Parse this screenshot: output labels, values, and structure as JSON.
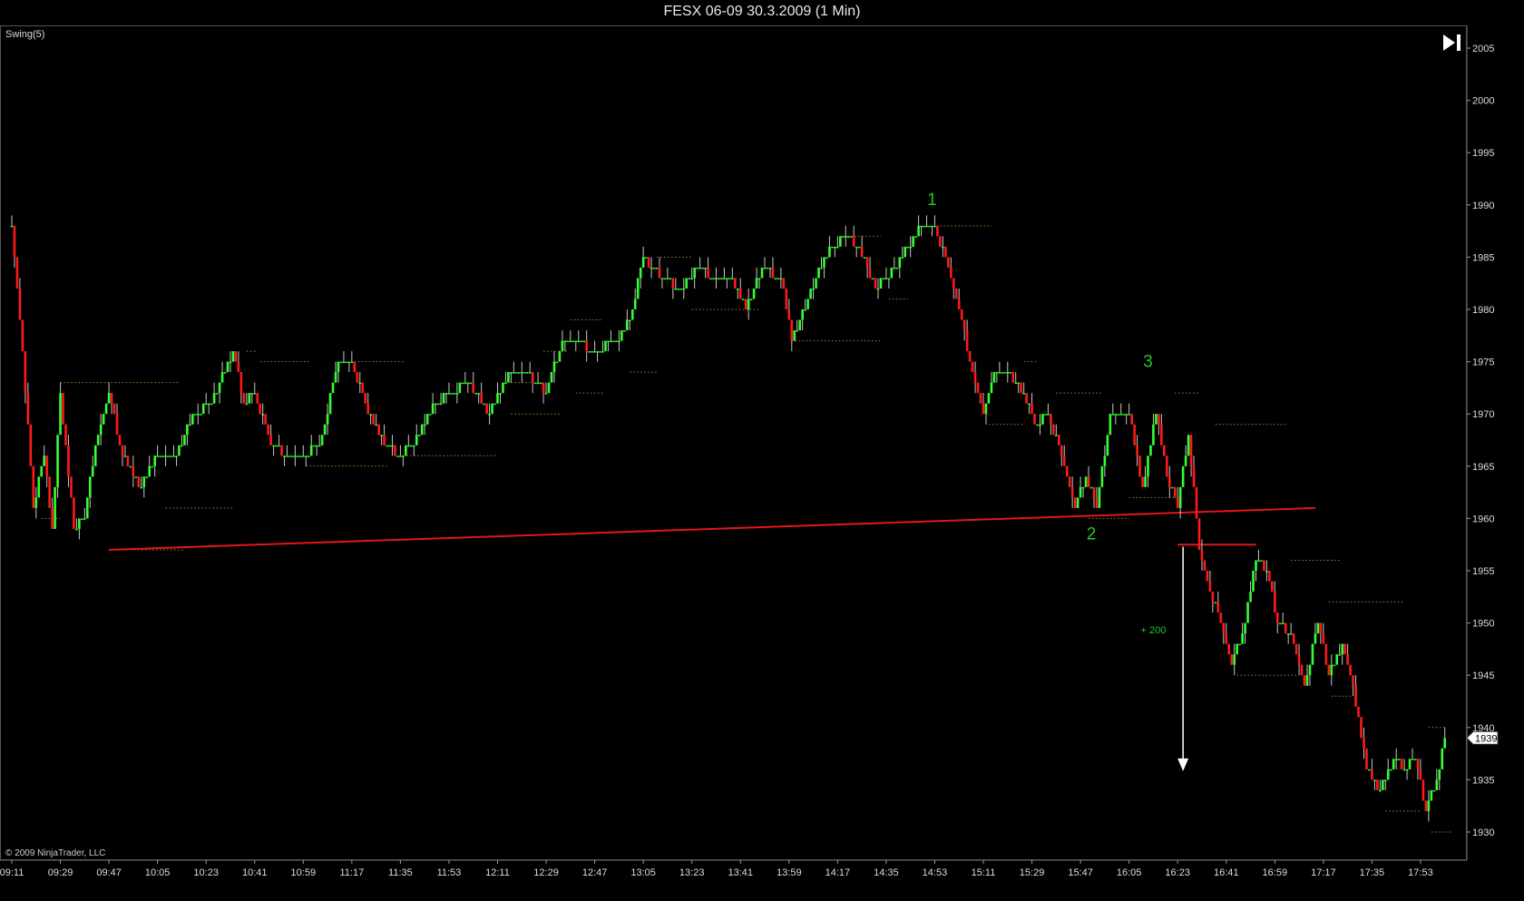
{
  "window": {
    "title": "FESX 06-09  30.3.2009 (1 Min)"
  },
  "indicator": {
    "label": "Swing(5)"
  },
  "copyright": "© 2009 NinjaTrader, LLC",
  "colors": {
    "background": "#000000",
    "up_bar": "#33ff33",
    "down_bar": "#ff1a1a",
    "wick": "#c8c8c8",
    "swing_line": "#b07a30",
    "trendline": "#e01818",
    "annotation": "#22c822",
    "arrow": "#ffffff"
  },
  "icons": {
    "scroll_end": "skip-to-end-icon"
  },
  "chart_data": {
    "type": "candlestick",
    "title": "FESX 06-09  30.3.2009 (1 Min)",
    "xlabel": "",
    "ylabel": "",
    "ylim": [
      1928,
      2007
    ],
    "x_ticks": [
      "09:11",
      "09:29",
      "09:47",
      "10:05",
      "10:23",
      "10:41",
      "10:59",
      "11:17",
      "11:35",
      "11:53",
      "12:11",
      "12:29",
      "12:47",
      "13:05",
      "13:23",
      "13:41",
      "13:59",
      "14:17",
      "14:35",
      "14:53",
      "15:11",
      "15:29",
      "15:47",
      "16:05",
      "16:23",
      "16:41",
      "16:59",
      "17:17",
      "17:35",
      "17:53"
    ],
    "y_ticks": [
      1930,
      1935,
      1940,
      1945,
      1950,
      1955,
      1960,
      1965,
      1970,
      1975,
      1980,
      1985,
      1990,
      1995,
      2000,
      2005
    ],
    "last_price": "1939",
    "price_path": [
      [
        "09:11",
        1988
      ],
      [
        "09:15",
        1976
      ],
      [
        "09:19",
        1961
      ],
      [
        "09:23",
        1966
      ],
      [
        "09:26",
        1959
      ],
      [
        "09:29",
        1972
      ],
      [
        "09:34",
        1959
      ],
      [
        "09:38",
        1960
      ],
      [
        "09:42",
        1967
      ],
      [
        "09:47",
        1972
      ],
      [
        "09:52",
        1966
      ],
      [
        "09:58",
        1963
      ],
      [
        "10:05",
        1966
      ],
      [
        "10:12",
        1966
      ],
      [
        "10:18",
        1970
      ],
      [
        "10:25",
        1971
      ],
      [
        "10:33",
        1976
      ],
      [
        "10:37",
        1971
      ],
      [
        "10:41",
        1972
      ],
      [
        "10:47",
        1967
      ],
      [
        "10:53",
        1966
      ],
      [
        "10:59",
        1966
      ],
      [
        "11:05",
        1967
      ],
      [
        "11:12",
        1975
      ],
      [
        "11:17",
        1975
      ],
      [
        "11:23",
        1970
      ],
      [
        "11:29",
        1967
      ],
      [
        "11:35",
        1966
      ],
      [
        "11:42",
        1968
      ],
      [
        "11:48",
        1971
      ],
      [
        "11:53",
        1972
      ],
      [
        "12:00",
        1973
      ],
      [
        "12:08",
        1970
      ],
      [
        "12:15",
        1974
      ],
      [
        "12:22",
        1974
      ],
      [
        "12:29",
        1972
      ],
      [
        "12:35",
        1977
      ],
      [
        "12:40",
        1977
      ],
      [
        "12:47",
        1976
      ],
      [
        "12:55",
        1977
      ],
      [
        "13:00",
        1979
      ],
      [
        "13:05",
        1985
      ],
      [
        "13:12",
        1983
      ],
      [
        "13:19",
        1982
      ],
      [
        "13:25",
        1984
      ],
      [
        "13:31",
        1983
      ],
      [
        "13:37",
        1983
      ],
      [
        "13:43",
        1980
      ],
      [
        "13:49",
        1984
      ],
      [
        "13:56",
        1983
      ],
      [
        "14:00",
        1977
      ],
      [
        "14:06",
        1981
      ],
      [
        "14:12",
        1985
      ],
      [
        "14:19",
        1987
      ],
      [
        "14:25",
        1986
      ],
      [
        "14:31",
        1982
      ],
      [
        "14:38",
        1984
      ],
      [
        "14:43",
        1986
      ],
      [
        "14:48",
        1988
      ],
      [
        "14:53",
        1988
      ],
      [
        "14:58",
        1984
      ],
      [
        "15:02",
        1980
      ],
      [
        "15:06",
        1975
      ],
      [
        "15:11",
        1970
      ],
      [
        "15:15",
        1974
      ],
      [
        "15:20",
        1974
      ],
      [
        "15:26",
        1972
      ],
      [
        "15:30",
        1969
      ],
      [
        "15:35",
        1970
      ],
      [
        "15:40",
        1966
      ],
      [
        "15:45",
        1961
      ],
      [
        "15:49",
        1964
      ],
      [
        "15:53",
        1961
      ],
      [
        "15:58",
        1970
      ],
      [
        "16:05",
        1970
      ],
      [
        "16:10",
        1963
      ],
      [
        "16:15",
        1970
      ],
      [
        "16:19",
        1964
      ],
      [
        "16:23",
        1961
      ],
      [
        "16:27",
        1968
      ],
      [
        "16:31",
        1957
      ],
      [
        "16:35",
        1953
      ],
      [
        "16:39",
        1950
      ],
      [
        "16:43",
        1946
      ],
      [
        "16:47",
        1949
      ],
      [
        "16:52",
        1956
      ],
      [
        "16:56",
        1955
      ],
      [
        "17:00",
        1950
      ],
      [
        "17:05",
        1949
      ],
      [
        "17:10",
        1944
      ],
      [
        "17:15",
        1950
      ],
      [
        "17:19",
        1945
      ],
      [
        "17:24",
        1948
      ],
      [
        "17:28",
        1944
      ],
      [
        "17:33",
        1936
      ],
      [
        "17:38",
        1934
      ],
      [
        "17:43",
        1937
      ],
      [
        "17:47",
        1936
      ],
      [
        "17:51",
        1937
      ],
      [
        "17:55",
        1932
      ],
      [
        "17:59",
        1935
      ],
      [
        "18:02",
        1939
      ]
    ],
    "swing_levels": [
      {
        "from": "09:29",
        "to": "10:13",
        "price": 1973
      },
      {
        "from": "09:22",
        "to": "09:29",
        "price": 1960
      },
      {
        "from": "09:47",
        "to": "10:15",
        "price": 1957
      },
      {
        "from": "10:08",
        "to": "10:33",
        "price": 1961
      },
      {
        "from": "10:38",
        "to": "10:42",
        "price": 1976
      },
      {
        "from": "10:43",
        "to": "11:01",
        "price": 1975
      },
      {
        "from": "11:00",
        "to": "11:30",
        "price": 1965
      },
      {
        "from": "11:18",
        "to": "11:36",
        "price": 1975
      },
      {
        "from": "11:36",
        "to": "12:11",
        "price": 1966
      },
      {
        "from": "12:16",
        "to": "12:24",
        "price": 1973
      },
      {
        "from": "12:16",
        "to": "12:34",
        "price": 1970
      },
      {
        "from": "12:28",
        "to": "12:37",
        "price": 1976
      },
      {
        "from": "12:38",
        "to": "12:50",
        "price": 1979
      },
      {
        "from": "12:40",
        "to": "12:50",
        "price": 1972
      },
      {
        "from": "13:00",
        "to": "13:10",
        "price": 1974
      },
      {
        "from": "13:10",
        "to": "13:23",
        "price": 1985
      },
      {
        "from": "13:23",
        "to": "13:48",
        "price": 1980
      },
      {
        "from": "14:00",
        "to": "14:33",
        "price": 1977
      },
      {
        "from": "14:18",
        "to": "14:33",
        "price": 1987
      },
      {
        "from": "14:36",
        "to": "14:43",
        "price": 1981
      },
      {
        "from": "14:55",
        "to": "15:14",
        "price": 1988
      },
      {
        "from": "15:13",
        "to": "15:26",
        "price": 1969
      },
      {
        "from": "15:26",
        "to": "15:31",
        "price": 1975
      },
      {
        "from": "15:38",
        "to": "15:55",
        "price": 1972
      },
      {
        "from": "15:50",
        "to": "16:05",
        "price": 1960
      },
      {
        "from": "16:05",
        "to": "16:22",
        "price": 1962
      },
      {
        "from": "16:22",
        "to": "16:31",
        "price": 1972
      },
      {
        "from": "16:37",
        "to": "17:03",
        "price": 1969
      },
      {
        "from": "16:45",
        "to": "17:07",
        "price": 1945
      },
      {
        "from": "17:05",
        "to": "17:23",
        "price": 1956
      },
      {
        "from": "17:19",
        "to": "17:47",
        "price": 1952
      },
      {
        "from": "17:20",
        "to": "17:28",
        "price": 1943
      },
      {
        "from": "17:40",
        "to": "17:53",
        "price": 1932
      },
      {
        "from": "17:57",
        "to": "18:05",
        "price": 1930
      },
      {
        "from": "17:56",
        "to": "18:02",
        "price": 1940
      }
    ],
    "trendline": {
      "from": [
        "09:47",
        1957
      ],
      "to": [
        "17:14",
        1961
      ]
    },
    "breakout_line": {
      "from": [
        "16:23",
        1957.5
      ],
      "to": [
        "16:52",
        1957.5
      ]
    },
    "target_arrow": {
      "x": "16:25",
      "from": 1957.3,
      "to": 1936.0
    },
    "annotations": [
      {
        "text": "1",
        "x": "14:52",
        "price": 1990
      },
      {
        "text": "2",
        "x": "15:51",
        "price": 1958
      },
      {
        "text": "3",
        "x": "16:12",
        "price": 1974.5
      },
      {
        "text": "+ 200",
        "x": "16:14",
        "price": 1949
      }
    ]
  }
}
